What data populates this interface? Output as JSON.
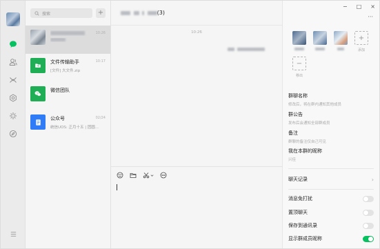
{
  "colors": {
    "accent": "#07c160",
    "file_helper": "#1fad55",
    "wechat_team": "#1fad55",
    "official": "#2f7cf6"
  },
  "search": {
    "placeholder": "搜索"
  },
  "add_button": "+",
  "conversations": [
    {
      "name": "",
      "preview": "",
      "time": "10:26",
      "active": true,
      "icon": "group-avatar"
    },
    {
      "name": "文件传输助手",
      "preview": "[文件] 大文件.zip",
      "time": "10:17",
      "icon": "folder-icon"
    },
    {
      "name": "微信团队",
      "preview": "",
      "time": "",
      "icon": "wechat-icon"
    },
    {
      "name": "公众号",
      "preview": "统信UOS: 正月十五 | 团圆...",
      "time": "02/24",
      "icon": "article-icon"
    }
  ],
  "chat": {
    "title_suffix": "(3)",
    "message_time": "10:26"
  },
  "window": {
    "minimize": "−",
    "maximize": "□",
    "close": "×",
    "more": "···"
  },
  "members": {
    "add_label": "添加",
    "remove_label": "移出"
  },
  "info": {
    "group_name": {
      "title": "群聊名称",
      "sub": "修改后，将在群内通知其他成员"
    },
    "announcement": {
      "title": "群公告",
      "sub": "发布后会通知全部群成员"
    },
    "remark": {
      "title": "备注",
      "sub": "群聊的备注仅自己可见"
    },
    "my_nickname": {
      "title": "我在本群的昵称",
      "sub": "兴佳"
    },
    "history": "聊天记录",
    "toggles": [
      {
        "label": "消息免打扰",
        "on": false
      },
      {
        "label": "置顶聊天",
        "on": false
      },
      {
        "label": "保存到通讯录",
        "on": false
      },
      {
        "label": "显示群成员昵称",
        "on": true
      }
    ]
  }
}
